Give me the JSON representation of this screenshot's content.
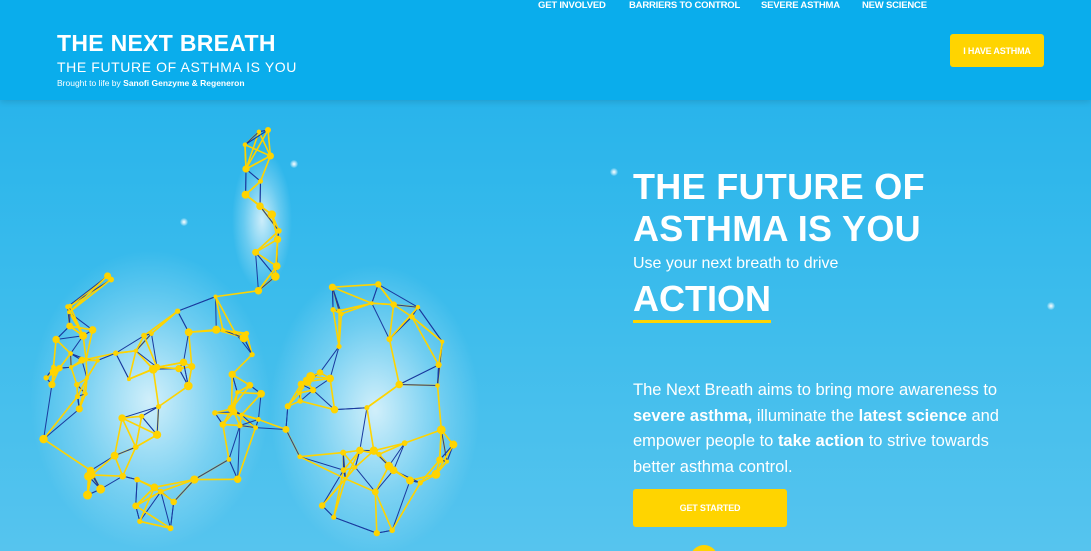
{
  "colors": {
    "header_bg": "#0aadec",
    "accent": "#ffd400",
    "text": "#ffffff",
    "lung_lines": "#1a3a9e"
  },
  "logo": {
    "title": "THE NEXT BREATH",
    "subtitle": "THE FUTURE OF ASTHMA IS YOU",
    "brought_prefix": "Brought to life by ",
    "brought_brand": "Sanofi Genzyme & Regeneron"
  },
  "nav": {
    "items": [
      "GET INVOLVED",
      "BARRIERS TO CONTROL",
      "SEVERE ASTHMA",
      "NEW SCIENCE"
    ],
    "cta": "I HAVE ASTHMA"
  },
  "hero": {
    "title_line1": "THE FUTURE OF",
    "title_line2": "ASTHMA IS YOU",
    "subtitle": "Use your next breath to drive",
    "action": "ACTION"
  },
  "description": {
    "t1": "The Next Breath aims to bring more awareness to ",
    "b1": "severe asthma,",
    "t2": " illuminate the ",
    "b2": "latest science",
    "t3": " and empower people to ",
    "b3": "take action",
    "t4": " to strive towards better asthma control."
  },
  "cta": {
    "label": "GET STARTED"
  },
  "illustration": {
    "icon": "lungs-network-icon"
  }
}
